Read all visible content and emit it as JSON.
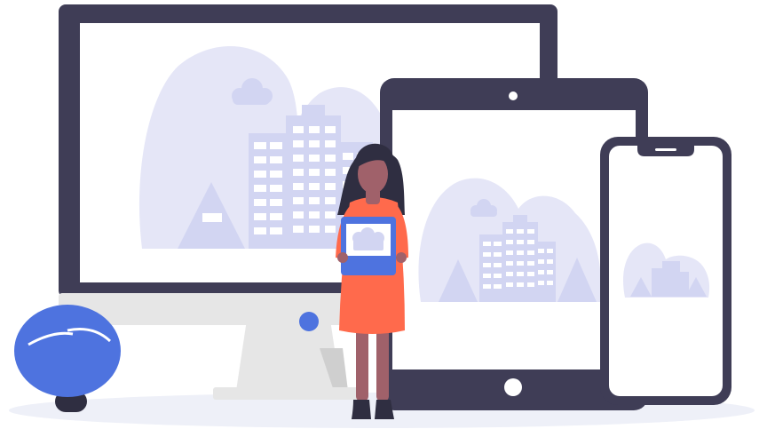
{
  "illustration": {
    "devices": [
      "desktop-monitor",
      "tablet",
      "smartphone"
    ],
    "figures": [
      "person-holding-tablet",
      "decorative-plant"
    ],
    "screen_content": "cityscape-illustration"
  },
  "colors": {
    "device_frame": "#3f3d56",
    "screen_bg": "#ffffff",
    "scene_shape": "#e5e6f7",
    "scene_detail": "#d2d5f2",
    "scene_window": "#ffffff",
    "accent_blue": "#4e73df",
    "dress": "#ff6a4c",
    "skin": "#a0616a",
    "hair": "#2f2e41",
    "stand": "#e6e6e6",
    "stand_shadow": "#cfcfcf",
    "ground": "#eef0f8"
  }
}
